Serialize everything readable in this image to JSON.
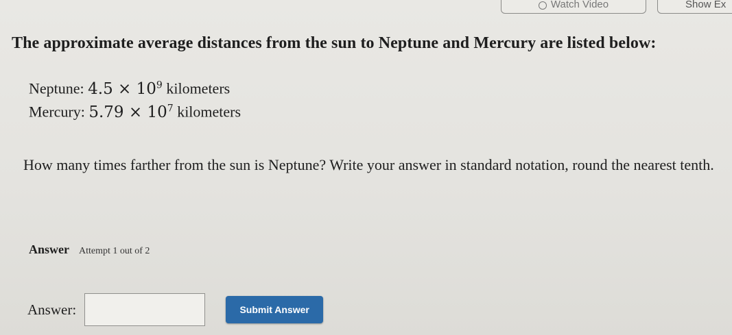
{
  "header": {
    "watch_video_label": "Watch Video",
    "show_example_label": "Show Ex"
  },
  "question": {
    "intro": "The approximate average distances from the sun to Neptune and Mercury are listed below:",
    "items": [
      {
        "name": "Neptune:",
        "coefficient": "4.5",
        "exponent": "9",
        "unit": "kilometers"
      },
      {
        "name": "Mercury:",
        "coefficient": "5.79",
        "exponent": "7",
        "unit": "kilometers"
      }
    ],
    "times_symbol": "×",
    "base": "10",
    "prompt": "How many times farther from the sun is Neptune? Write your answer in standard notation, round the nearest tenth."
  },
  "answer": {
    "section_label": "Answer",
    "attempt_text": "Attempt 1 out of 2",
    "field_label": "Answer:",
    "field_value": "",
    "submit_label": "Submit Answer"
  },
  "colors": {
    "background": "#e6e5e1",
    "submit_button": "#2b6aa8"
  }
}
